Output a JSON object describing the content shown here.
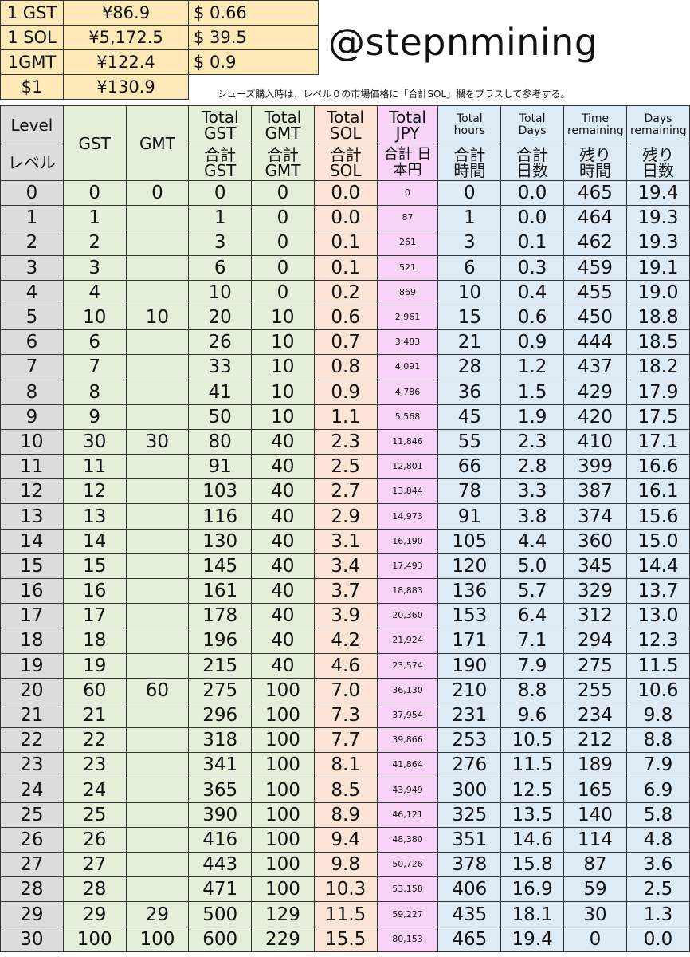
{
  "rates": [
    {
      "unit": "1 GST",
      "jpy": "¥86.9",
      "usd": "$ 0.66"
    },
    {
      "unit": "1 SOL",
      "jpy": "¥5,172.5",
      "usd": "$ 39.5"
    },
    {
      "unit": "1GMT",
      "jpy": "¥122.4",
      "usd": "$ 0.9"
    },
    {
      "unit": "$1",
      "jpy": "¥130.9",
      "usd": ""
    }
  ],
  "handle": "@stepnmining",
  "note": "シューズ購入時は、レベル０の市場価格に「合計SOL」欄をプラスして参考する。",
  "headers": {
    "level_en": "Level",
    "level_jp": "レベル",
    "gst": "GST",
    "gmt": "GMT",
    "total_gst_en": "Total GST",
    "total_gst_jp": "合計 GST",
    "total_gmt_en": "Total GMT",
    "total_gmt_jp": "合計 GMT",
    "total_sol_en": "Total SOL",
    "total_sol_jp": "合計 SOL",
    "total_jpy_en": "Total JPY",
    "total_jpy_jp": "合計 日本円",
    "total_hours_en": "Total hours",
    "total_hours_jp": "合計 時間",
    "total_days_en": "Total Days",
    "total_days_jp": "合計 日数",
    "time_rem_en": "Time remaining",
    "time_rem_jp": "残り 時間",
    "days_rem_en": "Days remaining",
    "days_rem_jp": "残り 日数"
  },
  "rows": [
    [
      "0",
      "0",
      "0",
      "0",
      "0",
      "0.0",
      "0",
      "0",
      "0.0",
      "465",
      "19.4"
    ],
    [
      "1",
      "1",
      "",
      "1",
      "0",
      "0.0",
      "87",
      "1",
      "0.0",
      "464",
      "19.3"
    ],
    [
      "2",
      "2",
      "",
      "3",
      "0",
      "0.1",
      "261",
      "3",
      "0.1",
      "462",
      "19.3"
    ],
    [
      "3",
      "3",
      "",
      "6",
      "0",
      "0.1",
      "521",
      "6",
      "0.3",
      "459",
      "19.1"
    ],
    [
      "4",
      "4",
      "",
      "10",
      "0",
      "0.2",
      "869",
      "10",
      "0.4",
      "455",
      "19.0"
    ],
    [
      "5",
      "10",
      "10",
      "20",
      "10",
      "0.6",
      "2,961",
      "15",
      "0.6",
      "450",
      "18.8"
    ],
    [
      "6",
      "6",
      "",
      "26",
      "10",
      "0.7",
      "3,483",
      "21",
      "0.9",
      "444",
      "18.5"
    ],
    [
      "7",
      "7",
      "",
      "33",
      "10",
      "0.8",
      "4,091",
      "28",
      "1.2",
      "437",
      "18.2"
    ],
    [
      "8",
      "8",
      "",
      "41",
      "10",
      "0.9",
      "4,786",
      "36",
      "1.5",
      "429",
      "17.9"
    ],
    [
      "9",
      "9",
      "",
      "50",
      "10",
      "1.1",
      "5,568",
      "45",
      "1.9",
      "420",
      "17.5"
    ],
    [
      "10",
      "30",
      "30",
      "80",
      "40",
      "2.3",
      "11,846",
      "55",
      "2.3",
      "410",
      "17.1"
    ],
    [
      "11",
      "11",
      "",
      "91",
      "40",
      "2.5",
      "12,801",
      "66",
      "2.8",
      "399",
      "16.6"
    ],
    [
      "12",
      "12",
      "",
      "103",
      "40",
      "2.7",
      "13,844",
      "78",
      "3.3",
      "387",
      "16.1"
    ],
    [
      "13",
      "13",
      "",
      "116",
      "40",
      "2.9",
      "14,973",
      "91",
      "3.8",
      "374",
      "15.6"
    ],
    [
      "14",
      "14",
      "",
      "130",
      "40",
      "3.1",
      "16,190",
      "105",
      "4.4",
      "360",
      "15.0"
    ],
    [
      "15",
      "15",
      "",
      "145",
      "40",
      "3.4",
      "17,493",
      "120",
      "5.0",
      "345",
      "14.4"
    ],
    [
      "16",
      "16",
      "",
      "161",
      "40",
      "3.7",
      "18,883",
      "136",
      "5.7",
      "329",
      "13.7"
    ],
    [
      "17",
      "17",
      "",
      "178",
      "40",
      "3.9",
      "20,360",
      "153",
      "6.4",
      "312",
      "13.0"
    ],
    [
      "18",
      "18",
      "",
      "196",
      "40",
      "4.2",
      "21,924",
      "171",
      "7.1",
      "294",
      "12.3"
    ],
    [
      "19",
      "19",
      "",
      "215",
      "40",
      "4.6",
      "23,574",
      "190",
      "7.9",
      "275",
      "11.5"
    ],
    [
      "20",
      "60",
      "60",
      "275",
      "100",
      "7.0",
      "36,130",
      "210",
      "8.8",
      "255",
      "10.6"
    ],
    [
      "21",
      "21",
      "",
      "296",
      "100",
      "7.3",
      "37,954",
      "231",
      "9.6",
      "234",
      "9.8"
    ],
    [
      "22",
      "22",
      "",
      "318",
      "100",
      "7.7",
      "39,866",
      "253",
      "10.5",
      "212",
      "8.8"
    ],
    [
      "23",
      "23",
      "",
      "341",
      "100",
      "8.1",
      "41,864",
      "276",
      "11.5",
      "189",
      "7.9"
    ],
    [
      "24",
      "24",
      "",
      "365",
      "100",
      "8.5",
      "43,949",
      "300",
      "12.5",
      "165",
      "6.9"
    ],
    [
      "25",
      "25",
      "",
      "390",
      "100",
      "8.9",
      "46,121",
      "325",
      "13.5",
      "140",
      "5.8"
    ],
    [
      "26",
      "26",
      "",
      "416",
      "100",
      "9.4",
      "48,380",
      "351",
      "14.6",
      "114",
      "4.8"
    ],
    [
      "27",
      "27",
      "",
      "443",
      "100",
      "9.8",
      "50,726",
      "378",
      "15.8",
      "87",
      "3.6"
    ],
    [
      "28",
      "28",
      "",
      "471",
      "100",
      "10.3",
      "53,158",
      "406",
      "16.9",
      "59",
      "2.5"
    ],
    [
      "29",
      "29",
      "29",
      "500",
      "129",
      "11.5",
      "59,227",
      "435",
      "18.1",
      "30",
      "1.3"
    ],
    [
      "30",
      "100",
      "100",
      "600",
      "229",
      "15.5",
      "80,153",
      "465",
      "19.4",
      "0",
      "0.0"
    ]
  ]
}
